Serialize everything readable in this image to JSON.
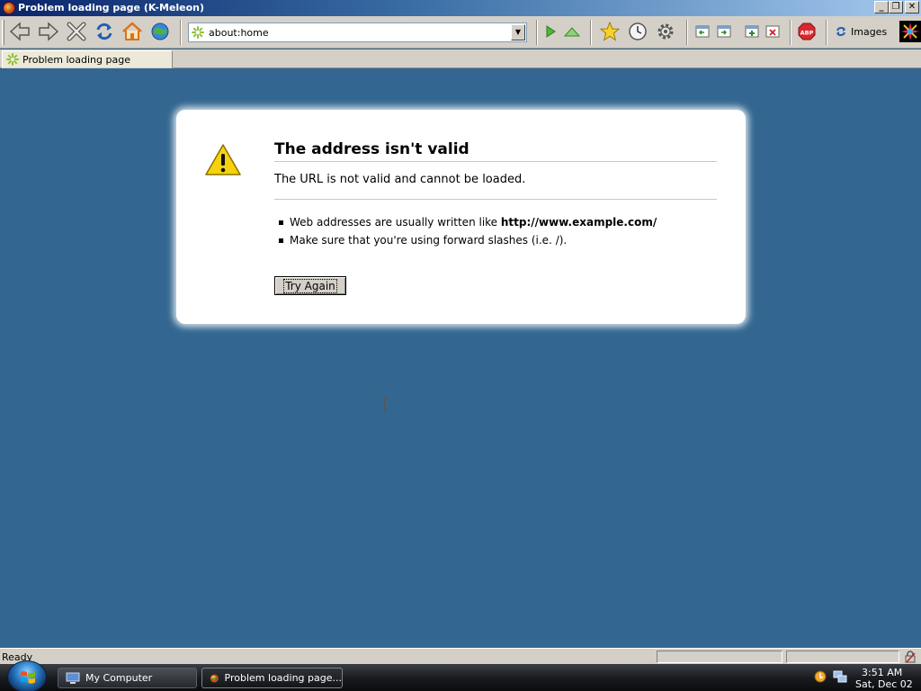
{
  "window": {
    "title": "Problem loading page (K-Meleon)",
    "buttons": {
      "minimize": "_",
      "maximize": "❐",
      "close": "✕"
    }
  },
  "toolbar": {
    "nav_icons": [
      "back-icon",
      "forward-icon",
      "stop-icon",
      "reload-icon",
      "home-icon",
      "world-icon"
    ],
    "address": {
      "value": "about:home",
      "dropdown_glyph": "▼"
    },
    "go_icons": [
      "go-icon",
      "up-icon"
    ],
    "tool_icons": [
      "bookmark-star-icon",
      "history-clock-icon",
      "settings-gear-icon"
    ],
    "window_icons": [
      "window-back-icon",
      "window-forward-icon",
      "new-window-icon",
      "close-window-icon"
    ],
    "adblock": {
      "icon": "adblock-plus-icon",
      "label": "ABP"
    },
    "images_label": "Images"
  },
  "tabs": [
    {
      "label": "Problem loading page"
    }
  ],
  "error": {
    "title": "The address isn't valid",
    "description": "The URL is not valid and cannot be loaded.",
    "tips": [
      {
        "text": "Web addresses are usually written like ",
        "bold": "http://www.example.com/"
      },
      {
        "text": "Make sure that you're using forward slashes (i.e. /).",
        "bold": ""
      }
    ],
    "button_label": "Try Again"
  },
  "status": {
    "text": "Ready"
  },
  "taskbar": {
    "tasks": [
      {
        "label": "My Computer",
        "icon": "computer-icon"
      },
      {
        "label": "Problem loading page...",
        "icon": "kmeleon-icon"
      }
    ],
    "clock": {
      "time": "3:51 AM",
      "date": "Sat, Dec 02"
    }
  },
  "colors": {
    "content_bg": "#336791",
    "chrome": "#d4d0c8",
    "title_gradient_start": "#0a246a",
    "title_gradient_end": "#a6caf0"
  }
}
